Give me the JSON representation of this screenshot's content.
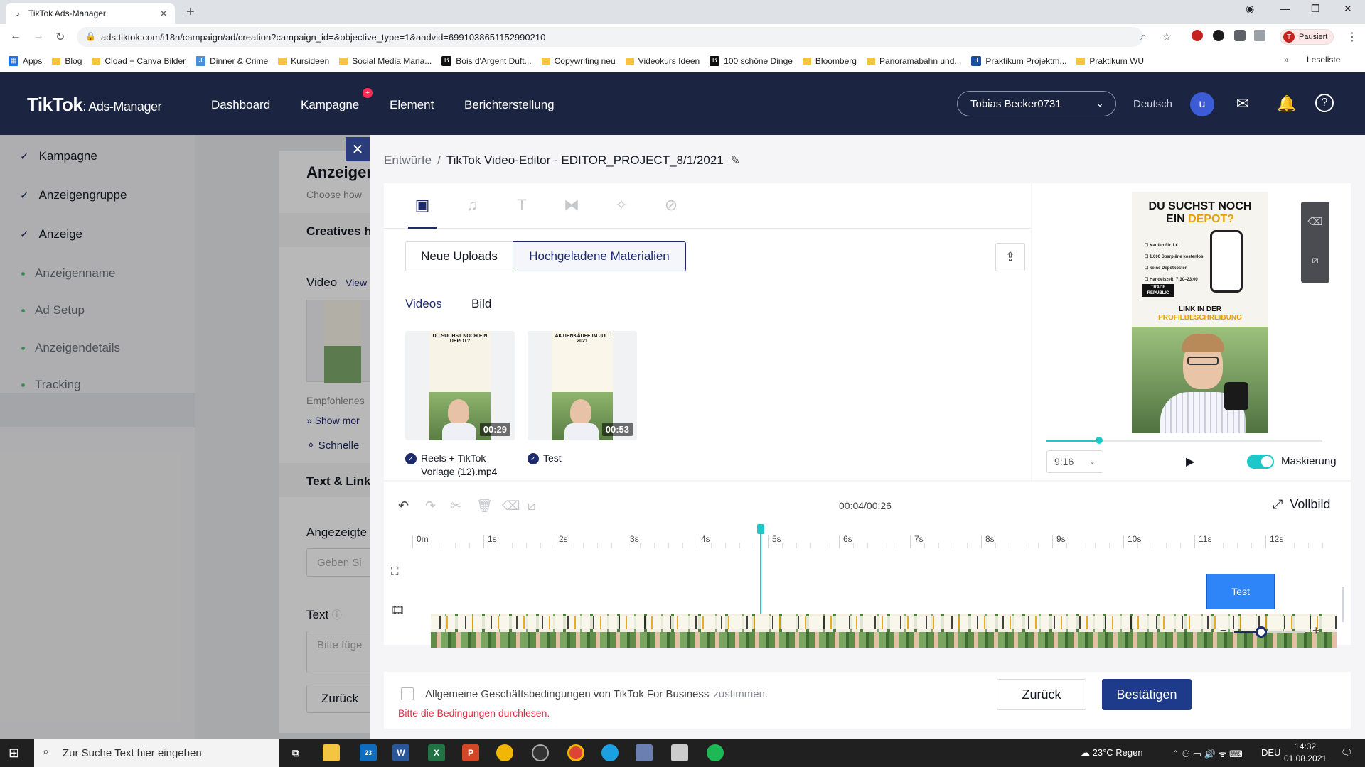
{
  "browser": {
    "tab_title": "TikTok Ads-Manager",
    "url": "ads.tiktok.com/i18n/campaign/ad/creation?campaign_id=&objective_type=1&aadvid=6991038651152990210",
    "profile_label": "Pausiert",
    "profile_initial": "T",
    "bookmarks": [
      "Apps",
      "Blog",
      "Cload + Canva Bilder",
      "Dinner & Crime",
      "Kursideen",
      "Social Media Mana...",
      "Bois d'Argent Duft...",
      "Copywriting neu",
      "Videokurs Ideen",
      "100 schöne Dinge",
      "Bloomberg",
      "Panoramabahn und...",
      "Praktikum Projektm...",
      "Praktikum WU"
    ],
    "reading_list": "Leseliste"
  },
  "header": {
    "logo": "TikTok",
    "logo_sub": "Ads-Manager",
    "nav": [
      "Dashboard",
      "Kampagne",
      "Element",
      "Berichterstellung"
    ],
    "account": "Tobias Becker0731",
    "language": "Deutsch",
    "avatar_initial": "u"
  },
  "leftnav": {
    "steps": [
      "Kampagne",
      "Anzeigengruppe",
      "Anzeige"
    ],
    "substeps": [
      "Anzeigenname",
      "Ad Setup",
      "Anzeigendetails",
      "Tracking"
    ]
  },
  "background_page": {
    "title": "Anzeigen",
    "subtitle": "Choose how",
    "creatives": "Creatives h",
    "video": "Video",
    "view": "View",
    "recommended": "Empfohlenes",
    "show_more": "Show mor",
    "quick": "Schnelle",
    "text_link": "Text & Link",
    "displayed": "Angezeigte",
    "enter_placeholder": "Geben Si",
    "text_label": "Text",
    "text_placeholder": "Bitte füge",
    "back": "Zurück"
  },
  "editor": {
    "breadcrumb_root": "Entwürfe",
    "breadcrumb_title": "TikTok Video-Editor - EDITOR_PROJECT_8/1/2021",
    "segment_new": "Neue Uploads",
    "segment_uploaded": "Hochgeladene Materialien",
    "subtab_videos": "Videos",
    "subtab_image": "Bild",
    "videos": [
      {
        "name": "Reels + TikTok Vorlage (12).mp4",
        "duration": "00:29",
        "thumb_title": "DU SUCHST NOCH EIN DEPOT?"
      },
      {
        "name": "Test",
        "duration": "00:53",
        "thumb_title": "AKTIENKÄUFE IM JULI 2021"
      }
    ],
    "preview": {
      "headline_a": "DU SUCHST NOCH",
      "headline_b": "EIN ",
      "headline_highlight": "DEPOT?",
      "list": [
        "Kaufen für 1 €",
        "1.000 Sparpläne kostenlos",
        "keine Depotkosten",
        "Handelszeit: 7:30–23:00"
      ],
      "brand": "TRADE REPUBLIC",
      "link_a": "LINK IN DER",
      "link_b": "PROFILBESCHREIBUNG",
      "progress": 0.19,
      "ratio": "9:16",
      "mask_label": "Maskierung",
      "mask_on": true
    },
    "timeline": {
      "time": "00:04/00:26",
      "fullscreen": "Vollbild",
      "ticks": [
        "0m",
        "1s",
        "2s",
        "3s",
        "4s",
        "5s",
        "6s",
        "7s",
        "8s",
        "9s",
        "10s",
        "11s",
        "12s"
      ],
      "text_clip": "Test",
      "cursor_seconds": 4.9
    },
    "terms_text": "Allgemeine Geschäftsbedingungen von TikTok For Business",
    "terms_suffix": "zustimmen.",
    "terms_warning": "Bitte die Bedingungen durchlesen.",
    "back_button": "Zurück",
    "confirm_button": "Bestätigen"
  },
  "taskbar": {
    "search_placeholder": "Zur Suche Text hier eingeben",
    "mail_badge": "23",
    "weather": "23°C  Regen",
    "lang": "DEU",
    "time": "14:32",
    "date": "01.08.2021"
  }
}
